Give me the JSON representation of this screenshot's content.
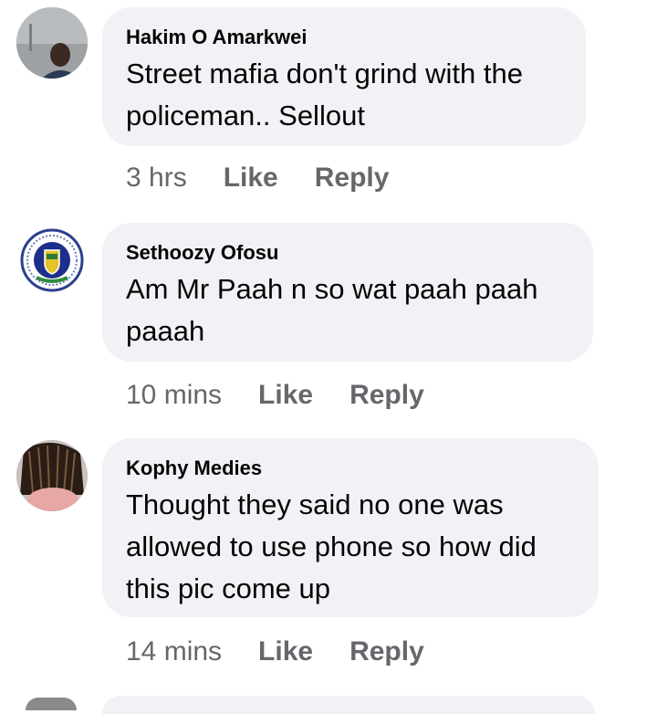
{
  "comments": [
    {
      "author": "Hakim O Amarkwei",
      "lines": [
        "Street mafia don't grind with the",
        "policeman.. Sellout"
      ],
      "time": "3 hrs",
      "like": "Like",
      "reply": "Reply"
    },
    {
      "author": "Sethoozy Ofosu",
      "lines": [
        "Am Mr Paah n so wat paah paah",
        "paaah"
      ],
      "time": "10 mins",
      "like": "Like",
      "reply": "Reply"
    },
    {
      "author": "Kophy Medies",
      "lines": [
        "Thought they said no one was",
        "allowed to use phone so how did",
        "this pic come up"
      ],
      "time": "14 mins",
      "like": "Like",
      "reply": "Reply"
    }
  ],
  "colors": {
    "bubble": "#f0f2f5",
    "meta": "#65676b",
    "text": "#050505"
  },
  "icons": [
    "person-photo-avatar",
    "crest-logo-avatar",
    "dreadlocks-photo-avatar"
  ]
}
